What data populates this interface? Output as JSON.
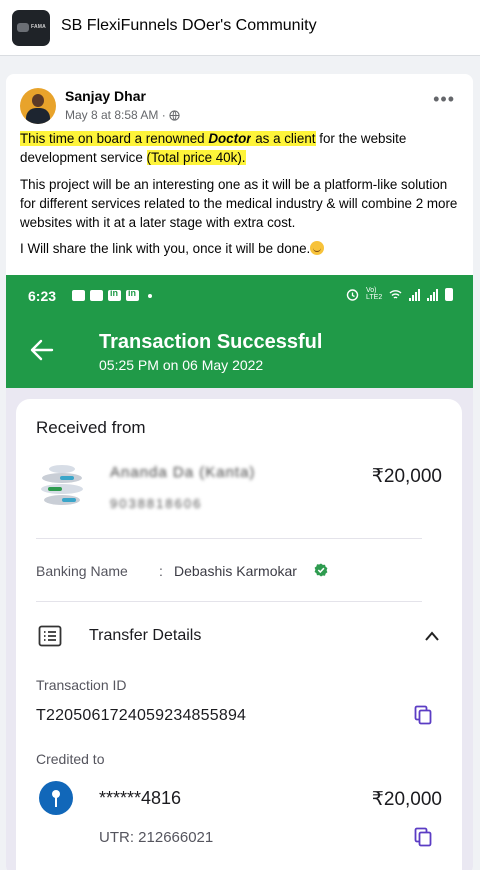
{
  "group": {
    "name": "SB FlexiFunnels DOer's Community",
    "logo_text": "FAMA"
  },
  "post": {
    "author": "Sanjay Dhar",
    "meta": "May 8 at 8:58 AM ·",
    "audience_icon": "globe-icon",
    "p1_a": "This time on board a renowned ",
    "p1_b": "Doctor",
    "p1_c": " as a client",
    "p1_d": " for the website development service ",
    "p1_e": "(Total price 40k).",
    "p2": "This project will be an interesting one as it will be a platform-like solution for different services related to the medical industry & will combine 2 more websites with it at a later stage with extra cost.",
    "p3": "I Will share the link with you, once it will be done.",
    "highlight_color": "#fef43a"
  },
  "screenshot": {
    "status_time": "6:23",
    "status_volte": "Vo) LTE2",
    "header_color": "#209a48",
    "title": "Transaction Successful",
    "subtitle": "05:25 PM on 06 May 2022",
    "received_from_label": "Received from",
    "payer_name": "Ananda Da (Kanta)",
    "payer_phone": "9038818606",
    "amount": "₹20,000",
    "banking_name_label": "Banking Name",
    "banking_sep": ":",
    "banking_name": "Debashis Karmokar",
    "transfer_details_label": "Transfer Details",
    "transaction_id_label": "Transaction ID",
    "transaction_id": "T2205061724059234855894",
    "credited_to_label": "Credited to",
    "account": "******4816",
    "credited_amount": "₹20,000",
    "utr": "UTR: 212666021"
  }
}
